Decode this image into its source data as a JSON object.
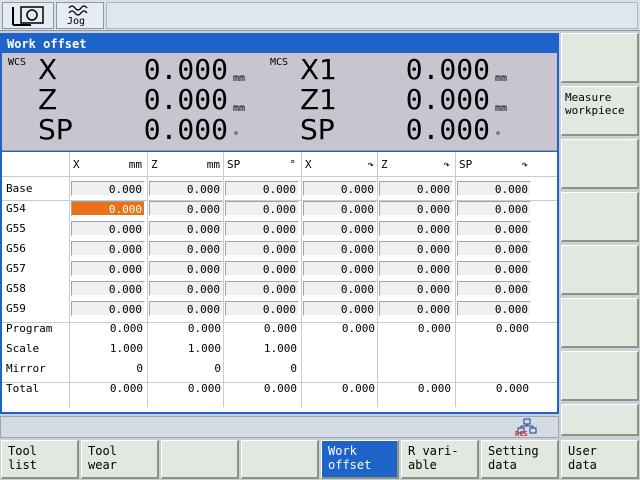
{
  "top": {
    "jog_label": "Jog"
  },
  "window": {
    "title": "Work offset",
    "wcs": {
      "label": "WCS",
      "rows": [
        {
          "axis": "X",
          "value": "0.000",
          "unit": "mm"
        },
        {
          "axis": "Z",
          "value": "0.000",
          "unit": "mm"
        },
        {
          "axis": "SP",
          "value": "0.000",
          "unit": "°"
        }
      ]
    },
    "mcs": {
      "label": "MCS",
      "rows": [
        {
          "axis": "X1",
          "value": "0.000",
          "unit": "mm"
        },
        {
          "axis": "Z1",
          "value": "0.000",
          "unit": "mm"
        },
        {
          "axis": "SP",
          "value": "0.000",
          "unit": "°"
        }
      ]
    }
  },
  "table": {
    "headers": [
      {
        "axis": "X",
        "unit": "mm"
      },
      {
        "axis": "Z",
        "unit": "mm"
      },
      {
        "axis": "SP",
        "unit": "°"
      },
      {
        "axis": "X",
        "unit": "↷"
      },
      {
        "axis": "Z",
        "unit": "↷"
      },
      {
        "axis": "SP",
        "unit": "↷"
      }
    ],
    "rows": [
      {
        "label": "Base",
        "cells": [
          "0.000",
          "0.000",
          "0.000",
          "0.000",
          "0.000",
          "0.000"
        ]
      },
      {
        "label": "G54",
        "cells": [
          "0.000",
          "0.000",
          "0.000",
          "0.000",
          "0.000",
          "0.000"
        ]
      },
      {
        "label": "G55",
        "cells": [
          "0.000",
          "0.000",
          "0.000",
          "0.000",
          "0.000",
          "0.000"
        ]
      },
      {
        "label": "G56",
        "cells": [
          "0.000",
          "0.000",
          "0.000",
          "0.000",
          "0.000",
          "0.000"
        ]
      },
      {
        "label": "G57",
        "cells": [
          "0.000",
          "0.000",
          "0.000",
          "0.000",
          "0.000",
          "0.000"
        ]
      },
      {
        "label": "G58",
        "cells": [
          "0.000",
          "0.000",
          "0.000",
          "0.000",
          "0.000",
          "0.000"
        ]
      },
      {
        "label": "G59",
        "cells": [
          "0.000",
          "0.000",
          "0.000",
          "0.000",
          "0.000",
          "0.000"
        ]
      },
      {
        "label": "Program",
        "cells": [
          "0.000",
          "0.000",
          "0.000",
          "0.000",
          "0.000",
          "0.000"
        ]
      },
      {
        "label": "Scale",
        "cells": [
          "1.000",
          "1.000",
          "1.000",
          "",
          "",
          ""
        ]
      },
      {
        "label": "Mirror",
        "cells": [
          "0",
          "0",
          "0",
          "",
          "",
          ""
        ]
      },
      {
        "label": "Total",
        "cells": [
          "0.000",
          "0.000",
          "0.000",
          "0.000",
          "0.000",
          "0.000"
        ]
      }
    ]
  },
  "status": {
    "icon_label": "RCS"
  },
  "softkeys_right": [
    "",
    "Measure workpiece",
    "",
    "",
    "",
    "",
    "",
    ""
  ],
  "softkeys_bottom": [
    "Tool list",
    "Tool wear",
    "",
    "",
    "Work offset",
    "R vari- able",
    "Setting data",
    "User data"
  ],
  "colors": {
    "title_bar": "#1e64c8",
    "selection": "#e8711a"
  }
}
